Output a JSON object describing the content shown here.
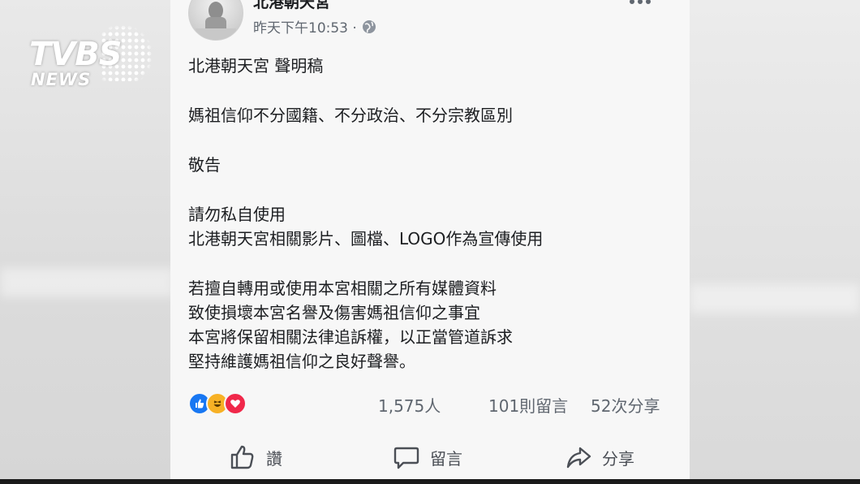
{
  "overlay": {
    "logo_main": "TVBS",
    "logo_sub": "NEWS"
  },
  "post": {
    "page_name": "北港朝天宮",
    "timestamp": "昨天下午10:53 ·",
    "privacy_icon": "globe-icon",
    "paragraphs": [
      "北港朝天宮  聲明稿",
      "媽祖信仰不分國籍、不分政治、不分宗教區別",
      "敬告",
      "請勿私自使用\n北港朝天宮相關影片、圖檔、LOGO作為宣傳使用",
      "若擅自轉用或使用本宮相關之所有媒體資料\n致使損壞本宮名譽及傷害媽祖信仰之事宜\n本宮將保留相關法律追訴權，以正當管道訴求\n堅持維護媽祖信仰之良好聲譽。"
    ]
  },
  "stats": {
    "reactions": "1,575人",
    "comments": "101則留言",
    "shares": "52次分享",
    "reaction_icons": [
      "like-icon",
      "haha-icon",
      "love-icon"
    ]
  },
  "actions": {
    "like": "讚",
    "comment": "留言",
    "share": "分享"
  },
  "colors": {
    "like_blue": "#1877f2",
    "haha_yellow": "#f7b125",
    "love_red": "#f0284a",
    "secondary_text": "#606770"
  }
}
